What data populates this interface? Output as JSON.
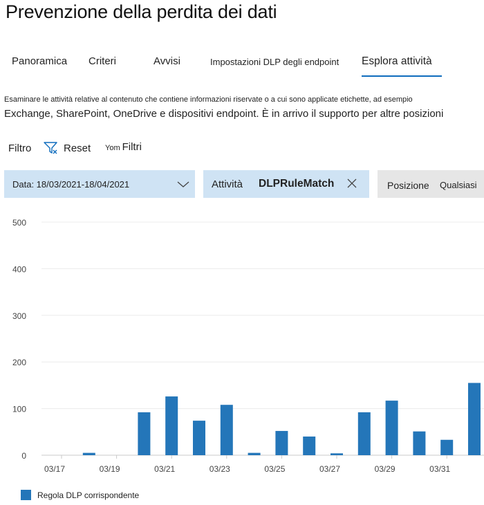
{
  "page": {
    "title": "Prevenzione della perdita dei dati"
  },
  "tabs": [
    {
      "label": "Panoramica"
    },
    {
      "label": "Criteri"
    },
    {
      "label": "Avvisi"
    },
    {
      "label": "Impostazioni DLP degli endpoint"
    },
    {
      "label": "Esplora attività",
      "active": true
    }
  ],
  "description": {
    "line1": "Esaminare le attività relative al contenuto che contiene informazioni riservate o a cui sono applicate etichette, ad esempio",
    "line2": "Exchange, SharePoint, OneDrive e dispositivi endpoint. È in arrivo il supporto per altre posizioni"
  },
  "filterbar": {
    "filter_label": "Filtro",
    "reset_label": "Reset",
    "filters_prefix": "Yom",
    "filters_label": "Filtri"
  },
  "chips": {
    "date": {
      "label": "Data: 18/03/2021-18/04/2021"
    },
    "activity": {
      "label": "Attività",
      "value": "DLPRuleMatch"
    },
    "location": {
      "label": "Posizione",
      "value": "Qualsiasi"
    }
  },
  "colors": {
    "accent": "#0f6cbd",
    "chip_active": "#cfe3f4",
    "chip_inactive": "#e6e6e6",
    "bar": "#2476b9"
  },
  "icons": [
    "filter-clear-icon",
    "chevron-down-icon",
    "close-icon"
  ],
  "chart_data": {
    "type": "bar",
    "categories": [
      "03/17",
      "03/18",
      "03/19",
      "03/20",
      "03/21",
      "03/22",
      "03/23",
      "03/24",
      "03/25",
      "03/26",
      "03/27",
      "03/28",
      "03/29",
      "03/30",
      "03/31",
      "04/01"
    ],
    "x_tick_labels": [
      "03/17",
      "03/19",
      "03/21",
      "03/23",
      "03/25",
      "03/27",
      "03/29",
      "03/31",
      "0"
    ],
    "series": [
      {
        "name": "Regola DLP corrispondente",
        "values": [
          0,
          5,
          0,
          92,
          126,
          74,
          108,
          5,
          52,
          40,
          4,
          92,
          117,
          51,
          33,
          155
        ]
      }
    ],
    "ylim": [
      0,
      500
    ],
    "yticks": [
      0,
      100,
      200,
      300,
      400,
      500
    ],
    "grid": true,
    "legend": "bottom-left"
  }
}
